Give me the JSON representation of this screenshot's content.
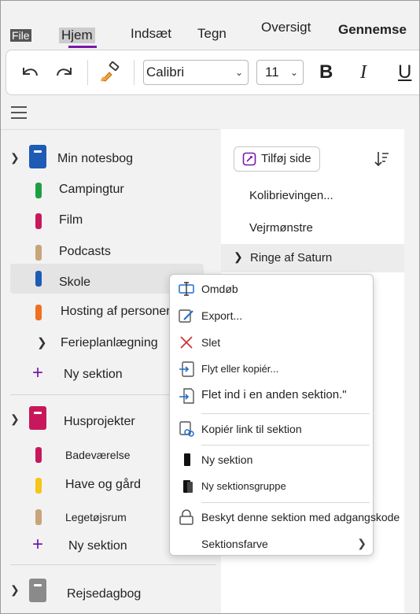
{
  "ribbon": {
    "tabs": [
      "File",
      "Hjem",
      "Indsæt",
      "Tegn",
      "Oversigt",
      "Gennemse"
    ],
    "active_tab": "Hjem"
  },
  "toolbar": {
    "undo_icon": "undo-icon",
    "redo_icon": "redo-icon",
    "format_painter_icon": "format-painter-icon",
    "font_name": "Calibri",
    "font_size": "11",
    "bold": "B",
    "italic": "I",
    "underline": "U"
  },
  "notebooks": [
    {
      "name": "Min notesbog",
      "color": "#1e5bb5",
      "expanded": true,
      "sections": [
        {
          "label": "Campingtur",
          "color": "#1e9e44"
        },
        {
          "label": "Film",
          "color": "#c8185b"
        },
        {
          "label": "Podcasts",
          "color": "#c8a47a"
        },
        {
          "label": "Skole",
          "color": "#1e5bb5",
          "selected": true
        },
        {
          "label": "Hosting af personer",
          "color": "#f07020"
        }
      ],
      "group": "Ferieplanlægning",
      "new_section": "Ny sektion"
    },
    {
      "name": "Husprojekter",
      "color": "#c8185b",
      "expanded": true,
      "sections": [
        {
          "label": "Badeværelse",
          "color": "#c8185b"
        },
        {
          "label": "Have og gård",
          "color": "#f5c518"
        },
        {
          "label": "Legetøjsrum",
          "color": "#c8a47a"
        }
      ],
      "new_section": "Ny sektion"
    },
    {
      "name": "Rejsedagbog",
      "color": "#8a8a8a",
      "expanded": false
    }
  ],
  "pages": {
    "add_page": "Tilføj side",
    "items": [
      "Kolibrievingen...",
      "Vejrmønstre",
      "Ringe af Saturn"
    ],
    "selected": "Ringe af Saturn"
  },
  "context_menu": {
    "items": [
      {
        "label": "Omdøb",
        "icon": "rename-icon"
      },
      {
        "label": "Export...",
        "icon": "export-icon"
      },
      {
        "label": "Slet",
        "icon": "delete-icon"
      },
      {
        "label": "Flyt eller kopiér...",
        "icon": "move-copy-icon"
      },
      {
        "label": "Flet ind i en anden sektion.\"",
        "icon": "merge-icon"
      },
      {
        "label": "Kopiér link til sektion",
        "icon": "copy-link-icon"
      },
      {
        "label": "Ny sektion",
        "icon": "new-section-icon"
      },
      {
        "label": "Ny sektionsgruppe",
        "icon": "new-section-group-icon"
      },
      {
        "label": "Beskyt denne sektion med adgangskode",
        "icon": "lock-icon"
      },
      {
        "label": "Sektionsfarve",
        "icon": "section-color-icon"
      }
    ]
  }
}
